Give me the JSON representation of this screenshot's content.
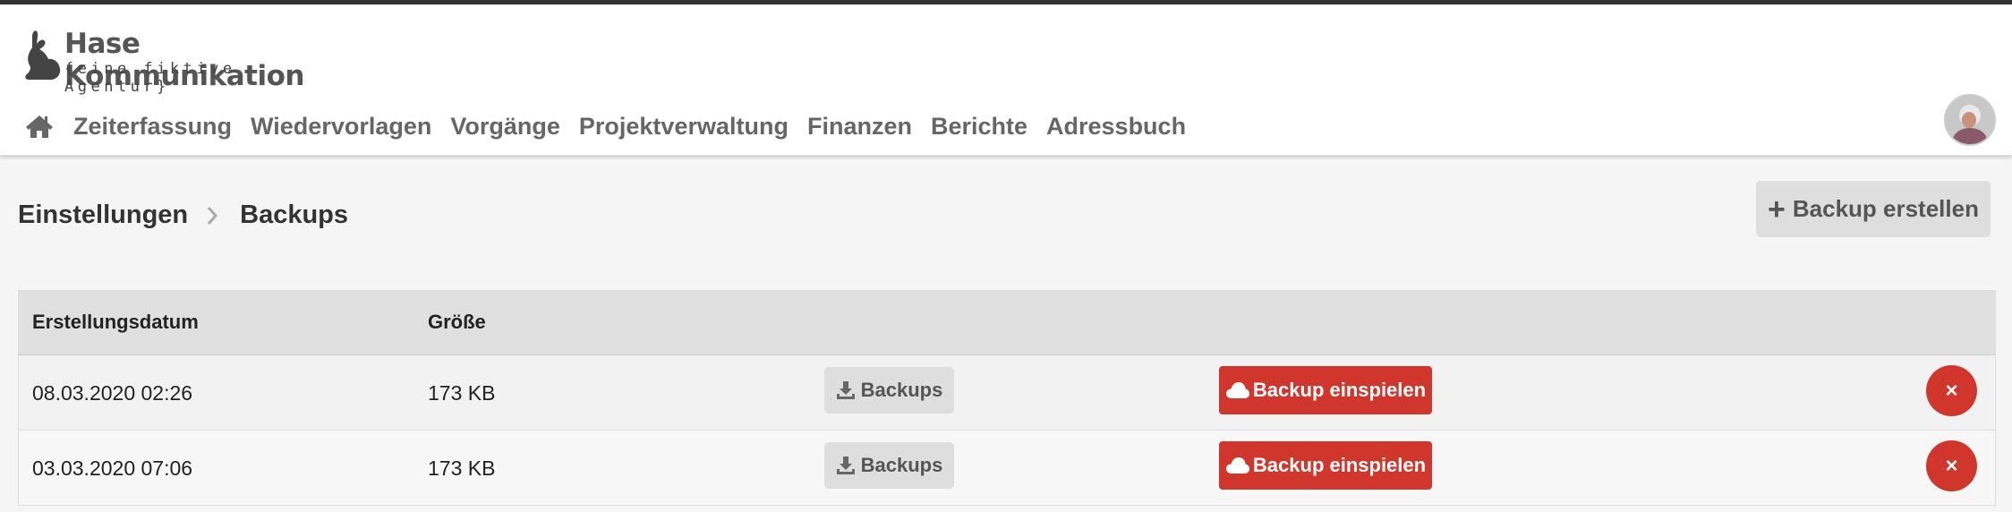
{
  "brand": {
    "name": "Hase  Kommunikation",
    "tagline": "{eine fiktive Agentur}",
    "icon": "rabbit-icon"
  },
  "nav": {
    "home_icon": "home-icon",
    "items": [
      {
        "label": "Zeiterfassung"
      },
      {
        "label": "Wiedervorlagen"
      },
      {
        "label": "Vorgänge"
      },
      {
        "label": "Projektverwaltung"
      },
      {
        "label": "Finanzen"
      },
      {
        "label": "Berichte"
      },
      {
        "label": "Adressbuch"
      }
    ]
  },
  "breadcrumb": {
    "parent": "Einstellungen",
    "current": "Backups",
    "separator_icon": "chevron-right-icon"
  },
  "actions": {
    "create_label": "Backup erstellen",
    "create_icon": "plus-icon"
  },
  "table": {
    "headers": {
      "date": "Erstellungsdatum",
      "size": "Größe"
    },
    "rows": [
      {
        "date": "08.03.2020 02:26",
        "size": "173 KB",
        "download_label": "Backups",
        "restore_label": "Backup einspielen",
        "delete_label": "×"
      },
      {
        "date": "03.03.2020 07:06",
        "size": "173 KB",
        "download_label": "Backups",
        "restore_label": "Backup einspielen",
        "delete_label": "×"
      }
    ]
  },
  "colors": {
    "danger": "#d0362c",
    "neutral_button": "#dedede",
    "header_bar": "#333333"
  }
}
